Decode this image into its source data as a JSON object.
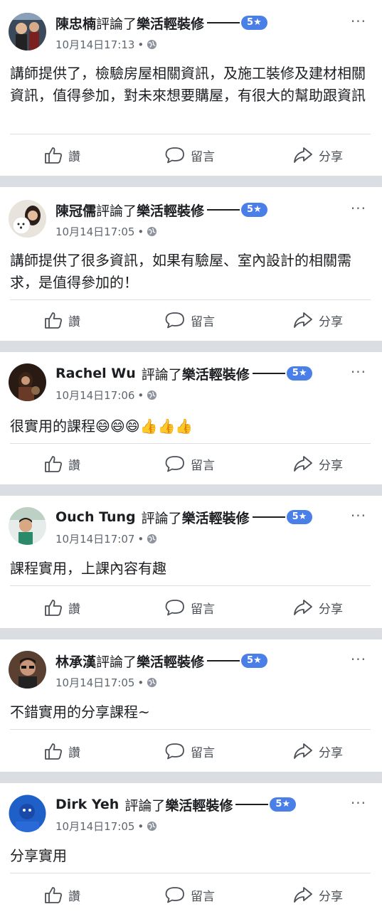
{
  "common": {
    "verb": "評論了",
    "page_name": "樂活輕裝修",
    "rating": "5★",
    "more": "···",
    "dot": "•",
    "like_label": "讚",
    "comment_label": "留言",
    "share_label": "分享"
  },
  "posts": [
    {
      "author": "陳忠楠",
      "timestamp": "10月14日17:13",
      "text": "講師提供了，檢驗房屋相關資訊，及施工裝修及建材相關資訊，值得參加，對未來想要購屋，有很大的幫助跟資訊"
    },
    {
      "author": "陳冠儒",
      "timestamp": "10月14日17:05",
      "text": "講師提供了很多資訊，如果有驗屋、室內設計的相關需求，是值得參加的！"
    },
    {
      "author": "Rachel Wu",
      "timestamp": "10月14日17:06",
      "text": "很實用的課程😄😄😄👍👍👍"
    },
    {
      "author": "Ouch Tung",
      "timestamp": "10月14日17:07",
      "text": "課程實用，上課內容有趣"
    },
    {
      "author": "林承漢",
      "timestamp": "10月14日17:05",
      "text": "不錯實用的分享課程~"
    },
    {
      "author": "Dirk Yeh",
      "timestamp": "10月14日17:05",
      "text": "分享實用"
    }
  ]
}
